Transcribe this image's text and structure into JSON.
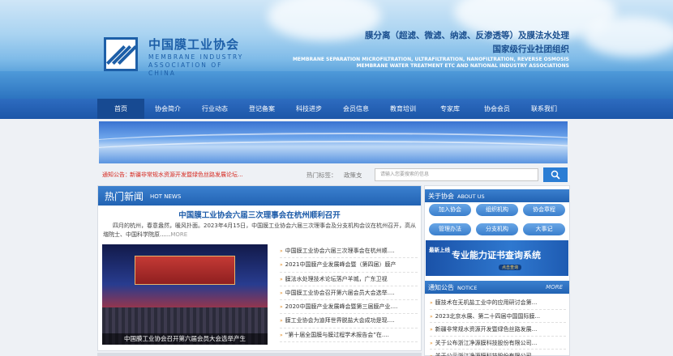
{
  "header": {
    "logo_cn": "中国膜工业协会",
    "logo_en": "MEMBRANE INDUSTRY ASSOCIATION OF CHINA",
    "slogan_line1": "膜分离（超滤、微滤、纳滤、反渗透等）及膜法水处理",
    "slogan_line2": "国家级行业社团组织",
    "slogan_en": "MEMBRANE SEPARATION MICROFILTRATION, ULTRAFILTRATION, NANOFILTRATION, REVERSE OSMOSIS MEMBRANE WATER TREATMENT ETC AND NATIONAL INDUSTRY ASSOCIATIONS"
  },
  "nav": {
    "items": [
      "首页",
      "协会简介",
      "行业动态",
      "登记备案",
      "科技进步",
      "会员信息",
      "教育培训",
      "专家库",
      "协会会员",
      "联系我们"
    ],
    "active_index": 0
  },
  "notice_bar": {
    "label": "通知公告：",
    "text": "新疆非常规水资源开发暨绿色丝路发展论坛...",
    "hot_label": "热门标签：",
    "hot_item": "政策支",
    "search_placeholder": "请输入您要搜索的信息"
  },
  "hot_news": {
    "title_cn": "热门新闻",
    "title_en": "HOT NEWS",
    "headline": "中国膜工业协会六届三次理事会在杭州顺利召开",
    "summary": "四月的杭州，春意盎然，暖风扑面。2023年4月15日，中国膜工业协会六届三次理事会及分支机构会议在杭州召开，高从堦院士、中国科学院原......",
    "more": "MORE",
    "photo_caption": "中国膜工业协会召开第六届会员大会选举产生",
    "items": [
      "中国膜工业协会六届三次理事会在杭州顺....",
      "2021中国膜产业发展峰会暨（第四届）膜产",
      "膜法水处理技术论坛落户羊城，广东卫视",
      "中国膜工业协会召开第六届会员大会选举....",
      "2020中国膜产业发展峰会暨第三届膜产业....",
      "膜工业协会为迪拜世界脱盐大会成功是现....",
      "“第十届全国膜与膜过程学术报告会”在...."
    ]
  },
  "sidebar": {
    "about_cn": "关于协会",
    "about_en": "ABOUT US",
    "buttons": [
      "加入协会",
      "组织机构",
      "协会章程",
      "管理办法",
      "分支机构",
      "大事记"
    ],
    "cert_new": "最新上线",
    "cert_title": "专业能力证书查询系统",
    "cert_sub": "点击查询",
    "notice_cn": "通知公告",
    "notice_en": "NOTICE",
    "notice_more": "MORE",
    "notice_items": [
      "膜技术在无机盐工业中的应用研讨会第...",
      "2023北京水展、第二十四届中国国际膜...",
      "新疆非常规水资源开发暨绿色丝路发展...",
      "关于公布浙江净源膜科技股份有限公司...",
      "关于公示浙江净源膜科技股份有限公司..."
    ]
  },
  "colors": {
    "primary": "#2263b3",
    "nav_active": "#174a92",
    "headline": "#1b5aa8",
    "notice_red": "#d6261d",
    "arrow_orange": "#e38a1f"
  },
  "icons": {
    "search": "search-icon",
    "list_arrow": "double-chevron-right-icon"
  }
}
